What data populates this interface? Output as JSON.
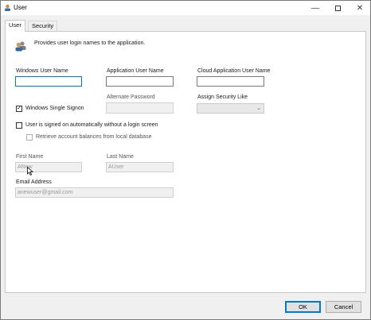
{
  "window": {
    "title": "User"
  },
  "tabs": [
    {
      "label": "User",
      "active": true
    },
    {
      "label": "Security",
      "active": false
    }
  ],
  "header": {
    "description": "Provides user login names to the application."
  },
  "form": {
    "windows_user_name": {
      "label": "Windows User Name",
      "value": ""
    },
    "application_user_name": {
      "label": "Application User Name",
      "value": ""
    },
    "cloud_application_user_name": {
      "label": "Cloud Application User Name",
      "value": ""
    },
    "windows_single_signon": {
      "label": "Windows Single Signon",
      "checked": true
    },
    "alternate_password": {
      "label": "Alternate Password",
      "value": ""
    },
    "assign_security_like": {
      "label": "Assign Security Like",
      "value": ""
    },
    "auto_signon": {
      "label": "User is signed on automatically without a login screen",
      "checked": false
    },
    "retrieve_balances": {
      "label": "Retrieve account balances from local database",
      "checked": false
    },
    "first_name": {
      "label": "First Name",
      "value": "ANew"
    },
    "last_name": {
      "label": "Last Name",
      "value": "AUser"
    },
    "email_address": {
      "label": "Email Address",
      "value": "anewuser@gmail.com"
    }
  },
  "buttons": {
    "ok": "OK",
    "cancel": "Cancel"
  },
  "colors": {
    "accent": "#0078d7",
    "window_bg": "#f0f0f0",
    "panel_bg": "#ffffff"
  },
  "icons": {
    "app": "user-app-icon",
    "header": "users-icon",
    "minimize": "minimize-icon",
    "maximize": "maximize-icon",
    "close": "close-icon"
  }
}
